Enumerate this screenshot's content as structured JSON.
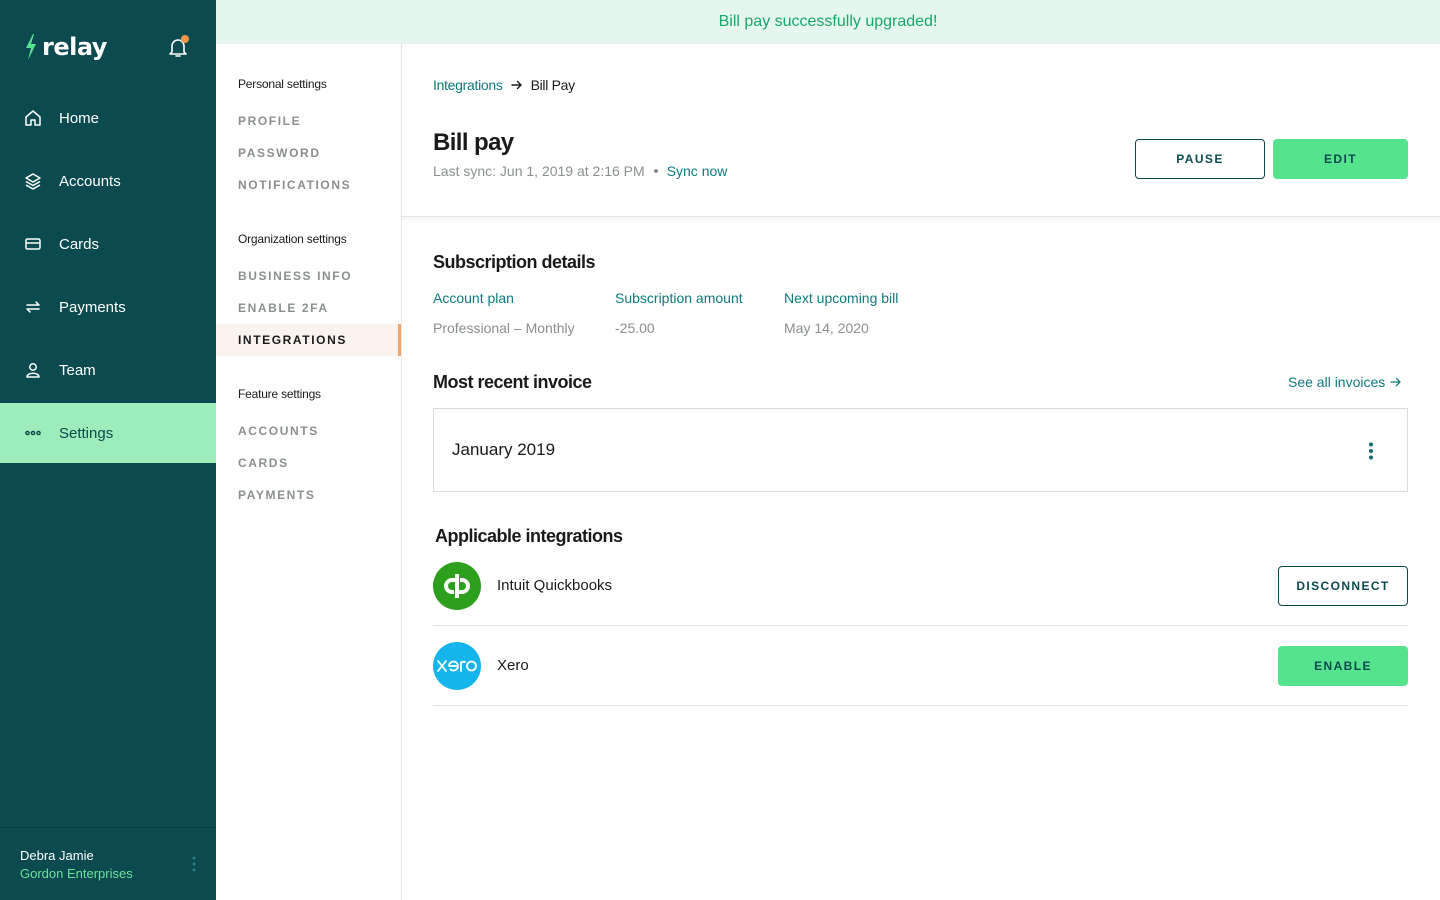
{
  "app": {
    "brand": "relay"
  },
  "banner": {
    "message": "Bill pay successfully upgraded!"
  },
  "sidebar": {
    "items": [
      {
        "label": "Home",
        "icon": "home-icon"
      },
      {
        "label": "Accounts",
        "icon": "layers-icon"
      },
      {
        "label": "Cards",
        "icon": "card-icon"
      },
      {
        "label": "Payments",
        "icon": "transfer-icon"
      },
      {
        "label": "Team",
        "icon": "person-icon"
      },
      {
        "label": "Settings",
        "icon": "more-dots-icon",
        "active": true
      }
    ],
    "user": {
      "name": "Debra Jamie",
      "org": "Gordon Enterprises"
    }
  },
  "settings_nav": {
    "groups": [
      {
        "title": "Personal settings",
        "items": [
          "PROFILE",
          "PASSWORD",
          "NOTIFICATIONS"
        ]
      },
      {
        "title": "Organization settings",
        "items": [
          "BUSINESS INFO",
          "ENABLE 2FA",
          "INTEGRATIONS"
        ]
      },
      {
        "title": "Feature settings",
        "items": [
          "ACCOUNTS",
          "CARDS",
          "PAYMENTS"
        ]
      }
    ],
    "active": "INTEGRATIONS"
  },
  "breadcrumb": {
    "parent": "Integrations",
    "current": "Bill Pay"
  },
  "page": {
    "title": "Bill pay",
    "last_sync": "Last sync: Jun 1, 2019 at 2:16 PM",
    "sync_now": "Sync now",
    "pause_label": "PAUSE",
    "edit_label": "EDIT"
  },
  "subscription": {
    "title": "Subscription details",
    "columns": [
      {
        "label": "Account plan",
        "value": "Professional – Monthly"
      },
      {
        "label": "Subscription amount",
        "value": "-25.00"
      },
      {
        "label": "Next upcoming bill",
        "value": "May 14, 2020"
      }
    ]
  },
  "invoice": {
    "title": "Most recent invoice",
    "see_all": "See all invoices",
    "latest": "January 2019"
  },
  "integrations": {
    "title": "Applicable integrations",
    "items": [
      {
        "name": "Intuit Quickbooks",
        "action": "DISCONNECT",
        "logo_text": "qb",
        "color": "#2ca01c"
      },
      {
        "name": "Xero",
        "action": "ENABLE",
        "logo_text": "xero",
        "color": "#13b5ea"
      }
    ]
  },
  "colors": {
    "sidebar_bg": "#0b4a4e",
    "accent_green": "#56e38d",
    "active_nav_bg": "#9cedbb",
    "link_teal": "#0f7a7f",
    "banner_bg": "#e5f6ee",
    "banner_text": "#17a86a",
    "notification_dot": "#f4954a"
  }
}
